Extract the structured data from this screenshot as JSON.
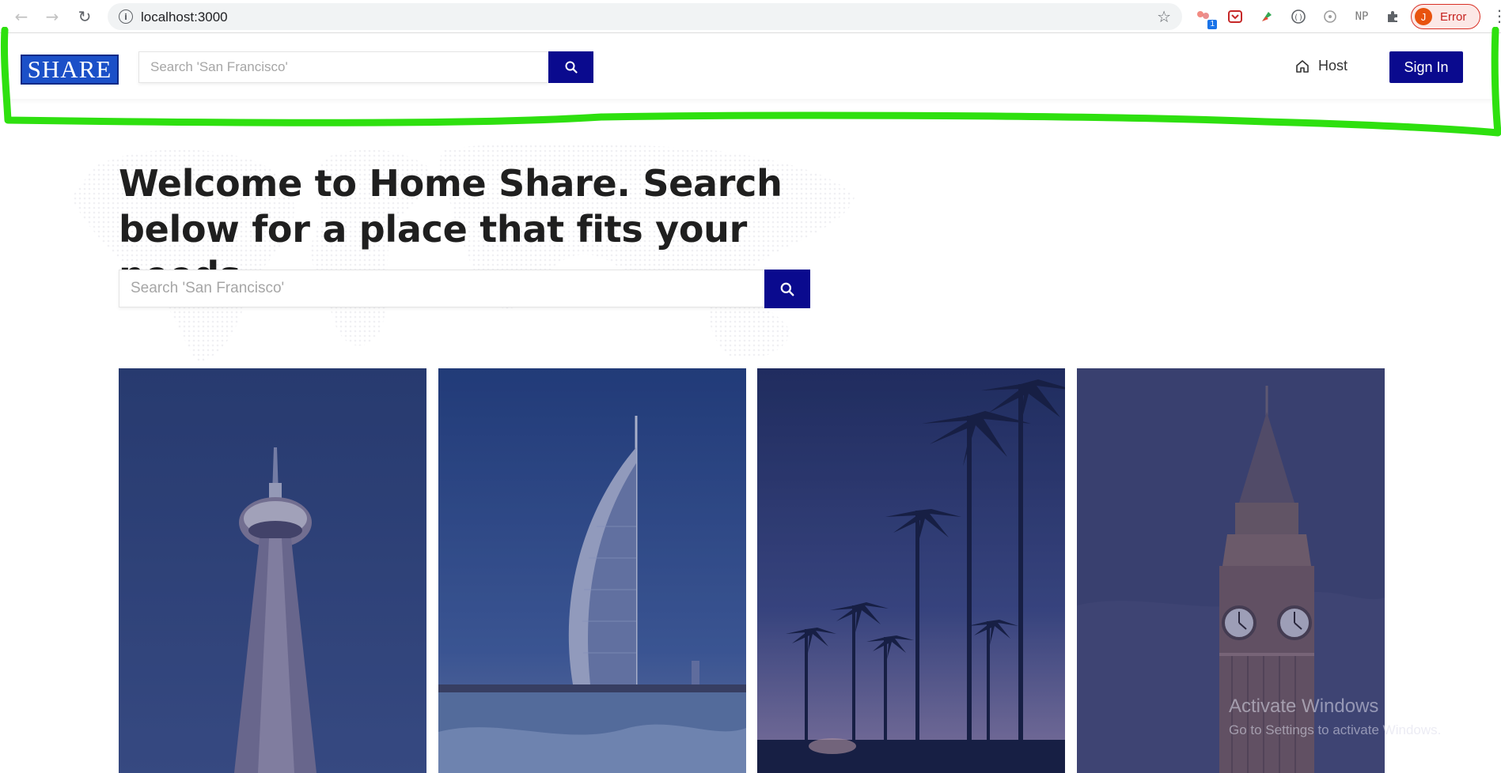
{
  "browser": {
    "url": "localhost:3000",
    "extension_badge": "1",
    "extension_np_label": "NP",
    "profile_initial": "J",
    "profile_label": "Error",
    "icons": [
      "back-arrow-icon",
      "forward-arrow-icon",
      "reload-icon",
      "info-icon",
      "star-icon",
      "puzzle-icon",
      "kebab-menu-icon"
    ]
  },
  "header": {
    "logo_text": "SHARE",
    "search_placeholder": "Search 'San Francisco'",
    "host_label": "Host",
    "signin_label": "Sign In"
  },
  "hero": {
    "title": "Welcome to Home Share. Search below for a place that fits your needs.",
    "search_placeholder": "Search 'San Francisco'"
  },
  "tiles": [
    {
      "subject": "cn-tower"
    },
    {
      "subject": "burj-al-arab"
    },
    {
      "subject": "palm-trees"
    },
    {
      "subject": "big-ben"
    }
  ],
  "colors": {
    "accent": "#0a0a8e",
    "logo_bg": "#1b50c8",
    "annotation": "#2ee00f",
    "tile_overlay": "#2b3a74"
  },
  "os_watermark": {
    "title": "Activate Windows",
    "subtitle": "Go to Settings to activate Windows."
  }
}
